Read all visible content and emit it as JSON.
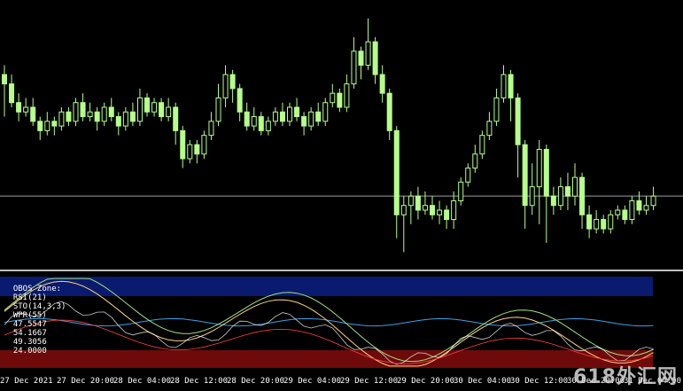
{
  "indicator_window": {
    "label_prefix": "OBOS Zone:",
    "params": [
      "RSI(21)",
      "STO(14,3,3)",
      "WPR(55)"
    ],
    "values": [
      "47.5547",
      "54.1667",
      "49.3056",
      "24.0000"
    ]
  },
  "time_axis": {
    "labels": [
      "27 Dec 2021",
      "27 Dec 20:00",
      "28 Dec 04:00",
      "28 Dec 12:00",
      "28 Dec 20:00",
      "29 Dec 04:00",
      "29 Dec 12:00",
      "29 Dec 20:00",
      "30 Dec 04:00",
      "30 Dec 12:00",
      "30 Dec 20:00",
      "31 Dec 04:00"
    ]
  },
  "watermark": "618外汇网",
  "colors": {
    "candle": "#b6ff8a",
    "price_line": "#a0a0a0",
    "overbought_zone": "#0a1a6e",
    "oversold_zone": "#6e0a0a",
    "rsi_line": "#3ca0e6",
    "sto_main": "#ffd27a",
    "sto_signal": "#a0e07a",
    "wpr_line": "#ffffff",
    "red_line": "#ff4040"
  },
  "chart_data": {
    "type": "candlestick",
    "candles": [
      [
        50,
        48,
        41,
        52
      ],
      [
        48,
        44,
        43,
        50
      ],
      [
        44,
        42,
        40,
        46
      ],
      [
        42,
        43,
        41,
        45
      ],
      [
        43,
        40,
        39,
        45
      ],
      [
        40,
        38,
        36,
        41
      ],
      [
        38,
        40,
        37,
        42
      ],
      [
        40,
        39,
        37,
        41
      ],
      [
        39,
        42,
        38,
        43
      ],
      [
        42,
        40,
        39,
        43
      ],
      [
        40,
        44,
        39,
        45
      ],
      [
        44,
        41,
        40,
        46
      ],
      [
        41,
        42,
        40,
        44
      ],
      [
        42,
        40,
        38,
        43
      ],
      [
        40,
        43,
        39,
        44
      ],
      [
        43,
        41,
        40,
        45
      ],
      [
        41,
        39,
        37,
        42
      ],
      [
        39,
        42,
        38,
        43
      ],
      [
        42,
        40,
        39,
        44
      ],
      [
        40,
        45,
        39,
        47
      ],
      [
        45,
        42,
        41,
        46
      ],
      [
        42,
        44,
        41,
        45
      ],
      [
        44,
        41,
        40,
        45
      ],
      [
        41,
        43,
        40,
        45
      ],
      [
        43,
        38,
        35,
        44
      ],
      [
        38,
        32,
        30,
        39
      ],
      [
        32,
        35,
        31,
        36
      ],
      [
        35,
        33,
        31,
        36
      ],
      [
        33,
        37,
        32,
        38
      ],
      [
        37,
        40,
        36,
        42
      ],
      [
        40,
        45,
        39,
        48
      ],
      [
        45,
        50,
        43,
        52
      ],
      [
        50,
        47,
        44,
        51
      ],
      [
        47,
        42,
        40,
        48
      ],
      [
        42,
        39,
        38,
        44
      ],
      [
        39,
        41,
        38,
        43
      ],
      [
        41,
        38,
        37,
        42
      ],
      [
        38,
        40,
        37,
        41
      ],
      [
        40,
        42,
        39,
        43
      ],
      [
        42,
        40,
        39,
        44
      ],
      [
        40,
        43,
        39,
        44
      ],
      [
        43,
        41,
        40,
        45
      ],
      [
        41,
        39,
        37,
        42
      ],
      [
        39,
        42,
        38,
        43
      ],
      [
        42,
        40,
        39,
        44
      ],
      [
        40,
        44,
        39,
        45
      ],
      [
        44,
        46,
        43,
        48
      ],
      [
        46,
        43,
        42,
        47
      ],
      [
        43,
        48,
        42,
        50
      ],
      [
        48,
        55,
        47,
        58
      ],
      [
        55,
        52,
        49,
        56
      ],
      [
        52,
        57,
        51,
        62
      ],
      [
        57,
        50,
        48,
        58
      ],
      [
        50,
        46,
        44,
        52
      ],
      [
        46,
        38,
        36,
        47
      ],
      [
        38,
        20,
        15,
        39
      ],
      [
        20,
        22,
        12,
        24
      ],
      [
        22,
        24,
        18,
        25
      ],
      [
        24,
        21,
        19,
        26
      ],
      [
        21,
        22,
        20,
        25
      ],
      [
        22,
        20,
        19,
        24
      ],
      [
        20,
        21,
        18,
        23
      ],
      [
        21,
        19,
        17,
        22
      ],
      [
        19,
        23,
        17,
        25
      ],
      [
        23,
        27,
        22,
        28
      ],
      [
        27,
        30,
        26,
        31
      ],
      [
        30,
        33,
        29,
        35
      ],
      [
        33,
        37,
        32,
        38
      ],
      [
        37,
        40,
        36,
        42
      ],
      [
        40,
        45,
        39,
        47
      ],
      [
        45,
        50,
        44,
        52
      ],
      [
        50,
        45,
        40,
        51
      ],
      [
        45,
        35,
        28,
        46
      ],
      [
        35,
        22,
        17,
        36
      ],
      [
        22,
        26,
        20,
        31
      ],
      [
        26,
        34,
        18,
        36
      ],
      [
        34,
        24,
        14,
        35
      ],
      [
        24,
        22,
        20,
        26
      ],
      [
        22,
        26,
        21,
        28
      ],
      [
        26,
        24,
        21,
        29
      ],
      [
        24,
        28,
        22,
        31
      ],
      [
        28,
        20,
        17,
        29
      ],
      [
        20,
        17,
        15,
        22
      ],
      [
        17,
        19,
        16,
        21
      ],
      [
        19,
        17,
        16,
        20
      ],
      [
        17,
        20,
        16,
        21
      ],
      [
        20,
        21,
        19,
        22
      ],
      [
        21,
        19,
        18,
        22
      ],
      [
        19,
        23,
        18,
        24
      ],
      [
        23,
        21,
        20,
        25
      ],
      [
        21,
        22,
        20,
        24
      ],
      [
        22,
        24,
        21,
        26
      ]
    ],
    "price_line_value": 24
  }
}
